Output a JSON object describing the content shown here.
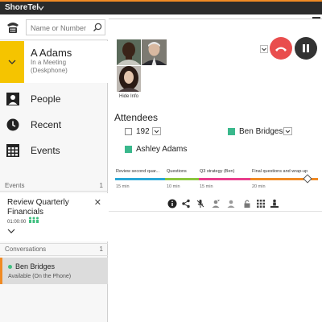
{
  "app": {
    "title": "ShoreTel"
  },
  "search": {
    "placeholder": "Name or Number",
    "value": ""
  },
  "user": {
    "name": "A Adams",
    "status": "In a Meeting (Deskphone)"
  },
  "nav": [
    {
      "label": "People",
      "icon": "person-icon"
    },
    {
      "label": "Recent",
      "icon": "clock-icon"
    },
    {
      "label": "Events",
      "icon": "calendar-icon"
    }
  ],
  "events": {
    "header": "Events",
    "count": "1",
    "item": {
      "title": "Review Quarterly Financials",
      "time": "01:00:00"
    }
  },
  "conversations": {
    "header": "Conversations",
    "count": "1",
    "item": {
      "name": "Ben Bridges",
      "status": "Available (On the Phone)"
    }
  },
  "call": {
    "hide_info": "Hide Info",
    "attendees_title": "Attendees",
    "attendees": [
      {
        "name": "192",
        "kind": "checkbox"
      },
      {
        "name": "Ben Bridges",
        "kind": "present"
      },
      {
        "name": "Ashley Adams",
        "kind": "present"
      }
    ],
    "agenda": [
      {
        "label": "Review second quar...",
        "time": "15 min",
        "color": "#2aa7d6"
      },
      {
        "label": "Questions",
        "time": "10 min",
        "color": "#8cc63f"
      },
      {
        "label": "Q3 strategy (Ben)",
        "time": "15 min",
        "color": "#e83e8c"
      },
      {
        "label": "Final questions and wrap-up",
        "time": "20 min",
        "color": "#f08a24"
      }
    ]
  },
  "colors": {
    "accent_orange": "#f08a24",
    "status_yellow": "#f5c400",
    "present_green": "#3ab88c",
    "hangup_red": "#e94e4e"
  }
}
